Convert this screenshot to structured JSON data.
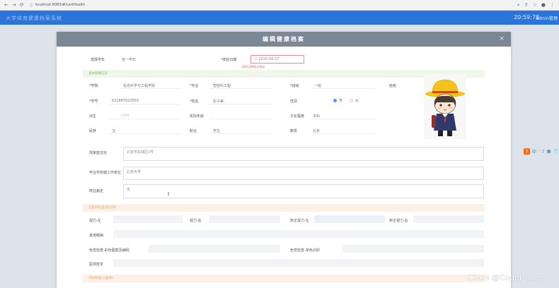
{
  "browser": {
    "url": "localhost:8083/#/certHealth"
  },
  "header": {
    "app_title": "大学体育健康档案系统",
    "clock": "20:59:78",
    "user": "admin管理"
  },
  "dialog": {
    "title": "编辑健康档案",
    "close": "×",
    "school_year_label": "选择学年",
    "school_year_value": "有一学年",
    "check_date_label": "*体检日期",
    "check_date_value": "2020-09-27",
    "check_date_error": "体检日期格式错误",
    "section_basic": "基本健康信息",
    "college_label": "*学院",
    "college_value": "信息科学与工程学院",
    "major_label": "*专业",
    "major_value": "智能科工程",
    "class_label": "*班级",
    "class_value": "一班",
    "grade_label": "班级",
    "student_id_label": "*学号",
    "student_id_value": "631887020555",
    "name_label": "*姓名",
    "name_value": "彭子美",
    "gender_label": "性别",
    "gender_male": "男",
    "gender_female": "女",
    "birth_label": "出生",
    "birth_value": "1999",
    "age_label": "实际年龄",
    "education_label": "文化程度",
    "education_value": "本科",
    "ethnicity_label": "民族",
    "ethnicity_value": "汉",
    "occupation_label": "职业",
    "occupation_value": "学生",
    "native_label": "籍贯",
    "native_value": "北京",
    "home_address_label": "现家庭住址",
    "home_address_value": "北京市东城区1号",
    "employer_label": "毕业学校或工作单位",
    "employer_value": "北京大学",
    "medical_history_label": "既往病史",
    "medical_history_value": "无",
    "section_vision": "五官科检查(视力等)",
    "left_eye_label": "视力-左",
    "right_eye_label": "视力-右",
    "corrected_left_label": "矫正视力-左",
    "corrected_right_label": "矫正视力-右",
    "other_eye_label": "其他眼病",
    "color_vision_label": "色觉检查-彩色图案及编码",
    "color_vision_single_label": "色觉检查-单色识别",
    "doctor_sign_label": "医师签字",
    "section_next": "内科检查(心脏等)"
  },
  "side_toolbar": {
    "logo": "S",
    "items": [
      "中",
      "·",
      "♪",
      "▦",
      "👕"
    ]
  },
  "watermark": "CSDN @Coder-coco",
  "colors": {
    "header_blue": "#2b74d9",
    "modal_header": "#7b8794",
    "section_green": "#eef7ea",
    "section_orange": "#fdf0e4",
    "error_red": "#e07070",
    "radio_blue": "#409eff"
  }
}
